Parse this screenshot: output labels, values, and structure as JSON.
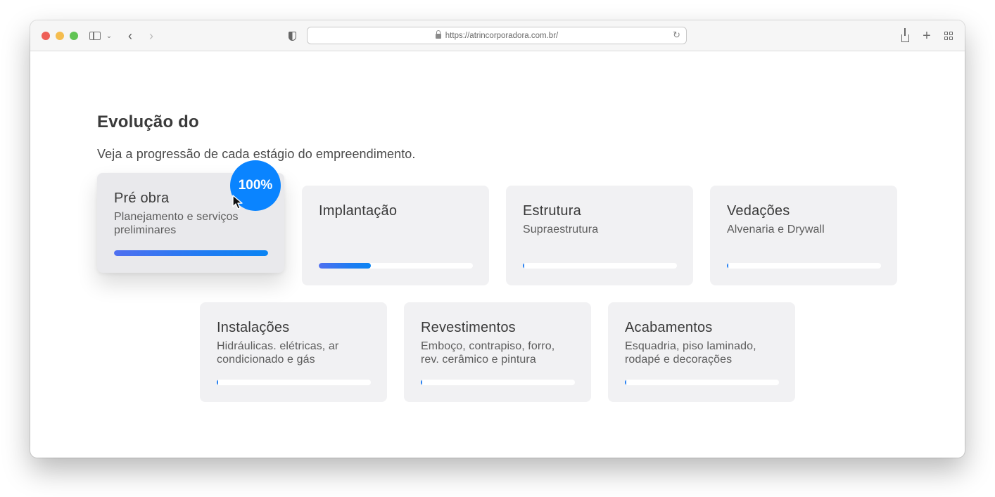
{
  "browser": {
    "url": "https://atrincorporadora.com.br/"
  },
  "section": {
    "title": "Evolução do",
    "subtitle": "Veja a progressão de cada estágio do empreendimento."
  },
  "stages": [
    {
      "title": "Pré obra",
      "description": "Planejamento e serviços preliminares",
      "progress": 1.0
    },
    {
      "title": "Implantação",
      "description": "",
      "progress": 0.34
    },
    {
      "title": "Estrutura",
      "description": "Supraestrutura",
      "progress": 0.0
    },
    {
      "title": "Vedações",
      "description": "Alvenaria e Drywall",
      "progress": 0.0
    },
    {
      "title": "Instalações",
      "description": "Hidráulicas. elétricas, ar condicionado e gás",
      "progress": 0.0
    },
    {
      "title": "Revestimentos",
      "description": "Emboço, contrapiso, forro, rev. cerâmico e pintura",
      "progress": 0.0
    },
    {
      "title": "Acabamentos",
      "description": "Esquadria, piso laminado, rodapé e decorações",
      "progress": 0.0
    }
  ],
  "badge": {
    "label": "100%"
  },
  "colors": {
    "accent": "#0a84ff",
    "card_bg": "#f1f1f3"
  },
  "icons": [
    "sidebar-icon",
    "chevron-down-icon",
    "back-arrow-icon",
    "forward-arrow-icon",
    "shield-icon",
    "lock-icon",
    "reload-icon",
    "share-icon",
    "plus-icon",
    "tabs-overview-icon",
    "mouse-pointer-icon"
  ]
}
